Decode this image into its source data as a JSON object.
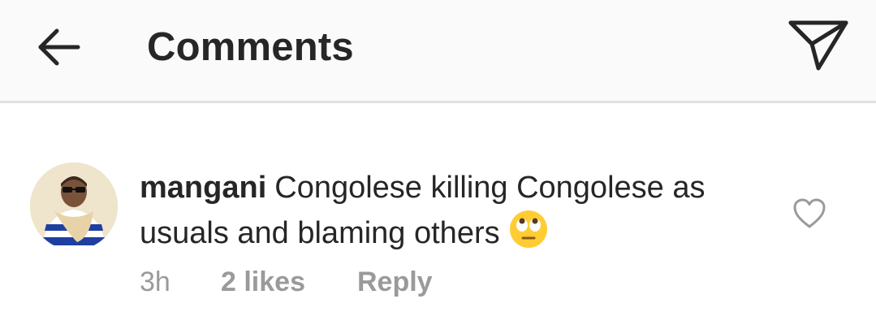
{
  "header": {
    "back_icon": "arrow-left-icon",
    "title": "Comments",
    "share_icon": "paper-plane-icon"
  },
  "comment": {
    "avatar_icon": "user-avatar",
    "username": "mangani",
    "text": "Congolese killing Congolese as usuals and blaming others",
    "emoji_icon": "eye-roll-emoji-icon",
    "like_icon": "heart-outline-icon",
    "time": "3h",
    "likes": "2 likes",
    "reply_label": "Reply"
  },
  "colors": {
    "header_bg": "#fafafa",
    "divider": "#e2e2e2",
    "text": "#262626",
    "meta": "#9a9a9a",
    "emoji": "#ffcc33"
  }
}
